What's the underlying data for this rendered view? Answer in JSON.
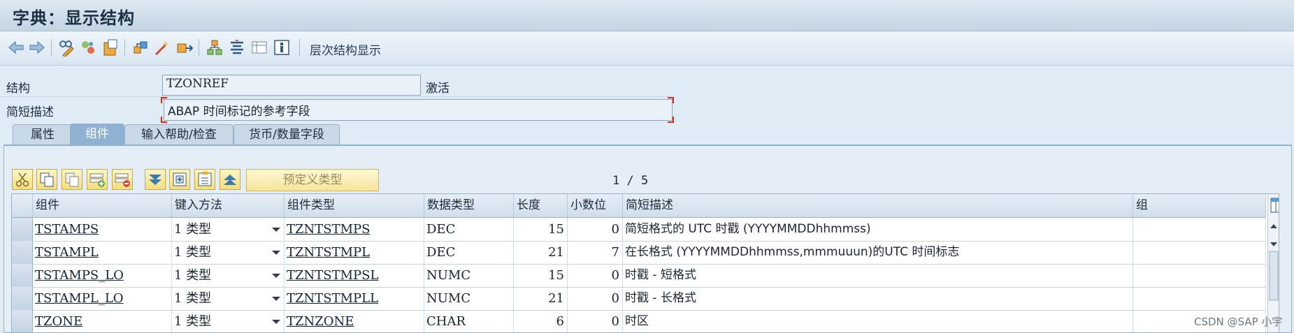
{
  "window": {
    "title": "字典：显示结构"
  },
  "toolbar": {
    "icons": [
      "back-icon",
      "forward-icon",
      "display-change-icon",
      "other-object-icon",
      "check-icon",
      "activate-icon",
      "where-used-icon",
      "object-list-icon",
      "display-navigation-icon",
      "info-icon"
    ],
    "hierarchy_label": "层次结构显示"
  },
  "header": {
    "structure_label": "结构",
    "structure_value": "TZONREF",
    "status": "激活",
    "short_desc_label": "简短描述",
    "short_desc_value": "ABAP 时间标记的参考字段"
  },
  "tabs": [
    {
      "label": "属性",
      "active": false
    },
    {
      "label": "组件",
      "active": true
    },
    {
      "label": "输入帮助/检查",
      "active": false
    },
    {
      "label": "货币/数量字段",
      "active": false
    }
  ],
  "grid_toolbar": {
    "predefined_type_label": "预定义类型",
    "pager": "1 / 5"
  },
  "table": {
    "columns": [
      "组件",
      "键入方法",
      "组件类型",
      "数据类型",
      "长度",
      "小数位",
      "简短描述",
      "组"
    ],
    "rows": [
      {
        "component": "TSTAMPS",
        "method": "1 类型",
        "type": "TZNTSTMPS",
        "datatype": "DEC",
        "length": "15",
        "decimals": "0",
        "desc": "简短格式的 UTC 时戳 (YYYYMMDDhhmmss)",
        "group": ""
      },
      {
        "component": "TSTAMPL",
        "method": "1 类型",
        "type": "TZNTSTMPL",
        "datatype": "DEC",
        "length": "21",
        "decimals": "7",
        "desc": "在长格式 (YYYYMMDDhhmmss,mmmuuun)的UTC 时间标志",
        "group": ""
      },
      {
        "component": "TSTAMPS_LO",
        "method": "1 类型",
        "type": "TZNTSTMPSL",
        "datatype": "NUMC",
        "length": "15",
        "decimals": "0",
        "desc": "时戳 - 短格式",
        "group": ""
      },
      {
        "component": "TSTAMPL_LO",
        "method": "1 类型",
        "type": "TZNTSTMPLL",
        "datatype": "NUMC",
        "length": "21",
        "decimals": "0",
        "desc": "时戳 - 长格式",
        "group": ""
      },
      {
        "component": "TZONE",
        "method": "1 类型",
        "type": "TZNZONE",
        "datatype": "CHAR",
        "length": "6",
        "decimals": "0",
        "desc": "时区",
        "group": ""
      }
    ]
  },
  "watermark": "CSDN @SAP 小宇"
}
